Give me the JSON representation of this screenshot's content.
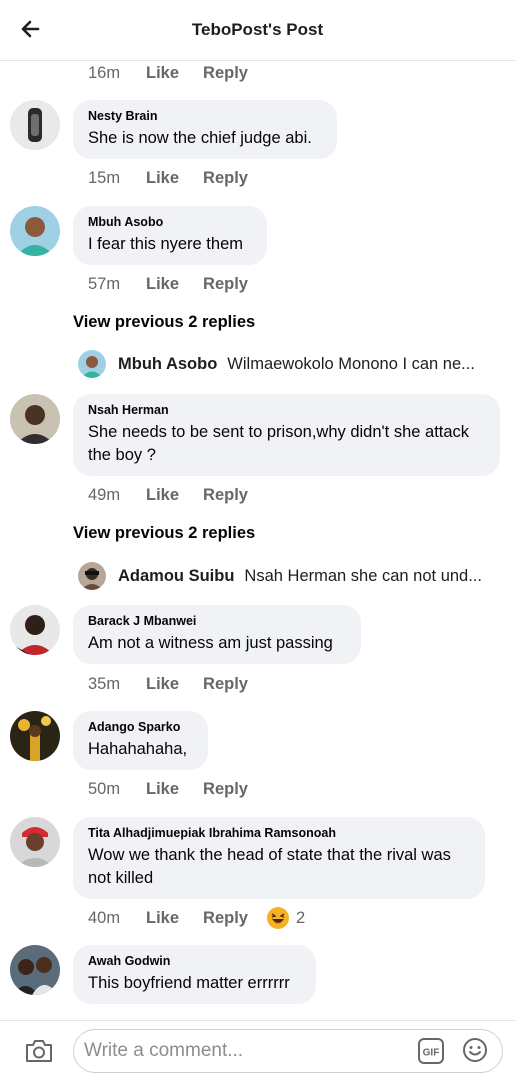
{
  "header": {
    "title": "TeboPost's Post"
  },
  "comments": [
    {
      "time": "16m",
      "like": "Like",
      "reply": "Reply"
    },
    {
      "name": "Nesty Brain",
      "text": "She is now the chief judge abi.",
      "time": "15m",
      "like": "Like",
      "reply": "Reply"
    },
    {
      "name": "Mbuh Asobo",
      "text": "I fear this nyere them",
      "time": "57m",
      "like": "Like",
      "reply": "Reply",
      "view_previous": "View previous 2 replies",
      "latest_reply": {
        "name": "Mbuh Asobo",
        "text": "Wilmaewokolo Monono I can ne..."
      }
    },
    {
      "name": "Nsah Herman",
      "text": "She needs to be sent to prison,why didn't she attack the boy ?",
      "time": "49m",
      "like": "Like",
      "reply": "Reply",
      "view_previous": "View previous 2 replies",
      "latest_reply": {
        "name": "Adamou Suibu",
        "text": "Nsah Herman she can not und..."
      }
    },
    {
      "name": "Barack J Mbanwei",
      "text": "Am not a witness am just passing",
      "time": "35m",
      "like": "Like",
      "reply": "Reply"
    },
    {
      "name": "Adango Sparko",
      "text": "Hahahahaha,",
      "time": "50m",
      "like": "Like",
      "reply": "Reply"
    },
    {
      "name": "Tita Alhadjimuepiak Ibrahima Ramsonoah",
      "text": "Wow we thank the head of state that the rival was not killed",
      "time": "40m",
      "like": "Like",
      "reply": "Reply",
      "reaction": {
        "icon": "laughing-emoji",
        "count": "2"
      }
    },
    {
      "name": "Awah Godwin",
      "text": "This boyfriend matter errrrrr"
    }
  ],
  "composer": {
    "placeholder": "Write a comment...",
    "gif_label": "GIF"
  },
  "colors": {
    "bubble": "#f0f2f5",
    "meta_text": "#65676b",
    "border": "#e4e6eb",
    "reaction": "#f7b125"
  }
}
